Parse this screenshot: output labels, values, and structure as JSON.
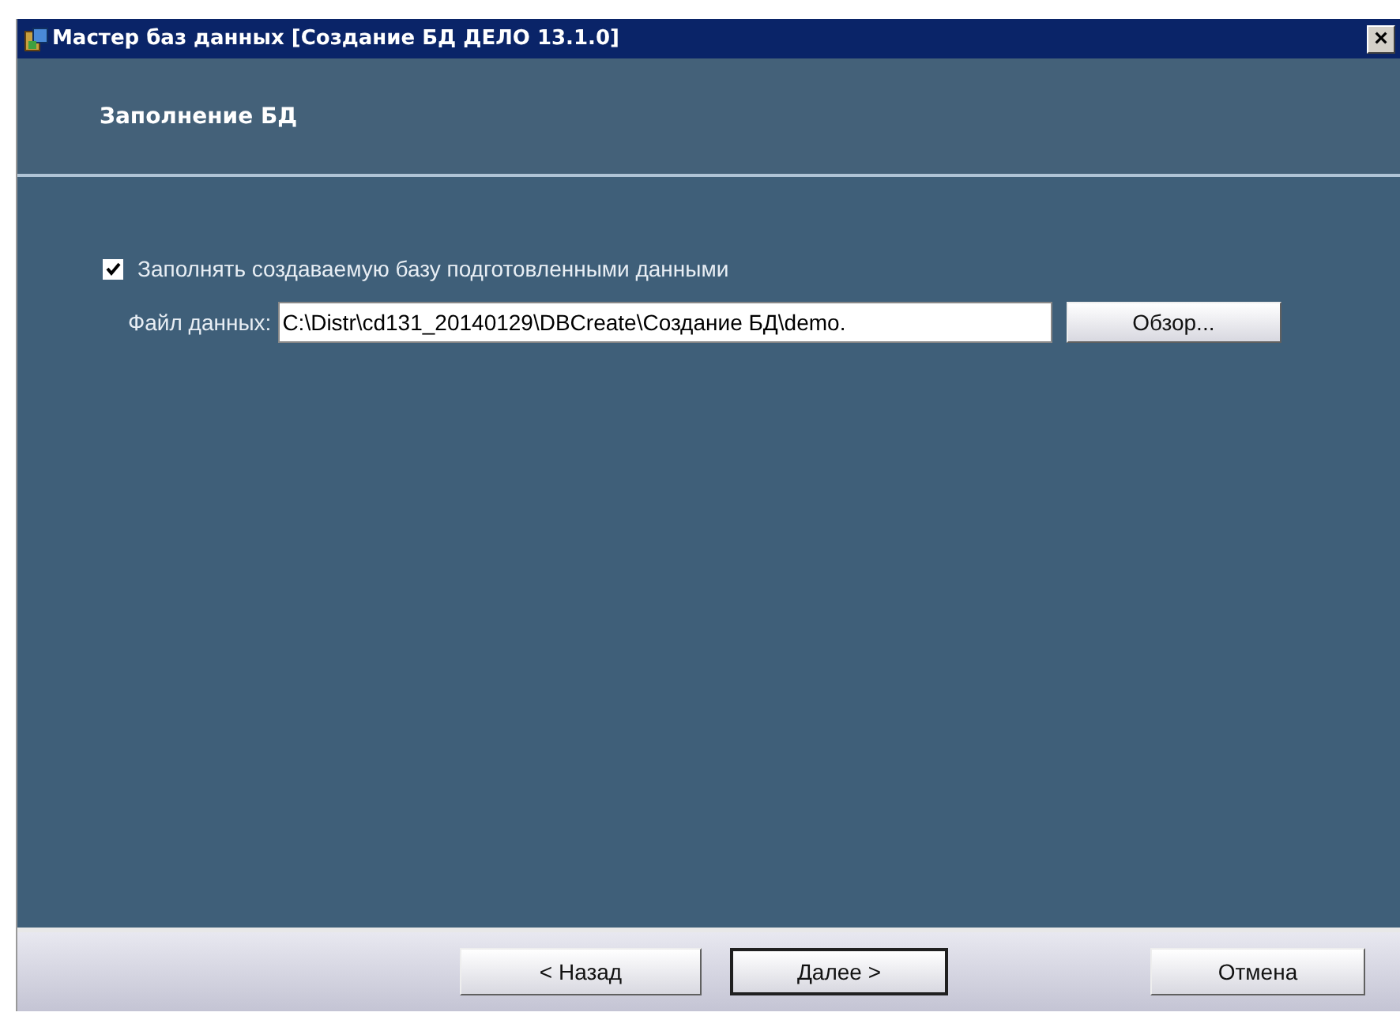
{
  "window": {
    "title": "Мастер баз данных [Создание БД ДЕЛО 13.1.0]",
    "close": "×"
  },
  "header": {
    "title": "Заполнение БД"
  },
  "fill_option": {
    "label": "Заполнять создаваемую базу подготовленными данными",
    "checked": true
  },
  "data_file": {
    "label": "Файл данных:",
    "value": "C:\\Distr\\cd131_20140129\\DBCreate\\Создание БД\\demo.",
    "browse": "Обзор..."
  },
  "buttons": [
    {
      "label": "< Назад",
      "default": false
    },
    {
      "label": "Далее >",
      "default": true
    },
    {
      "label": "Отмена",
      "default": false
    }
  ]
}
